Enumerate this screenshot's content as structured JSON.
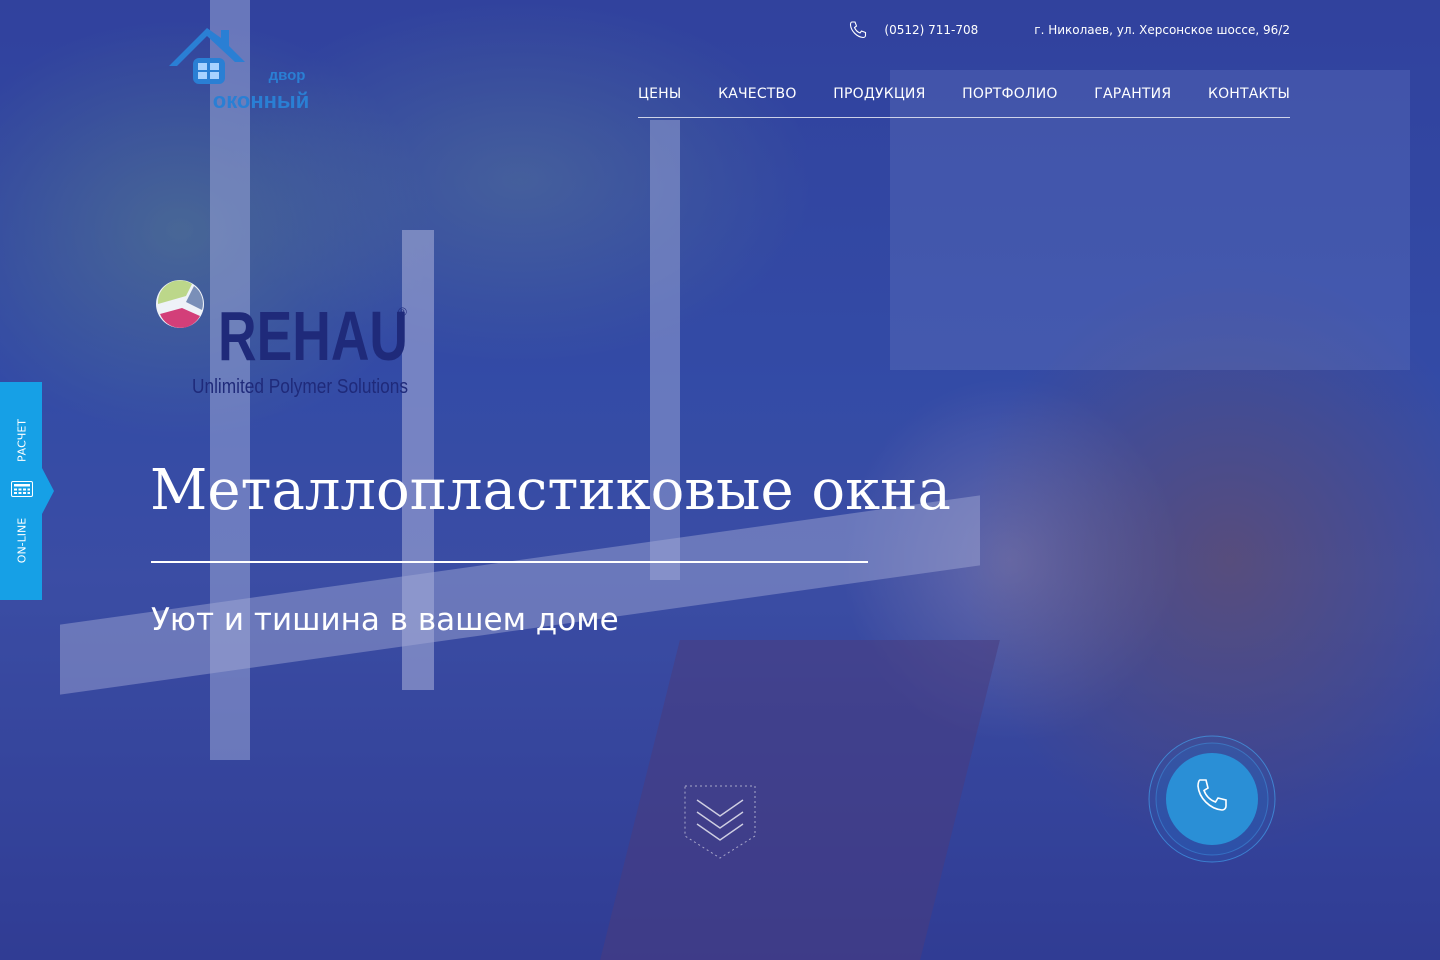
{
  "header": {
    "phone": "(0512) 711-708",
    "address": "г. Николаев,  ул. Херсонское шоссе, 96/2",
    "logo": {
      "line1": "двор",
      "line2": "оконный"
    }
  },
  "nav": {
    "items": [
      "ЦЕНЫ",
      "КАЧЕСТВО",
      "ПРОДУКЦИЯ",
      "ПОРТФОЛИО",
      "ГАРАНТИЯ",
      "КОНТАКТЫ"
    ]
  },
  "brand": {
    "name": "REHAU",
    "tagline": "Unlimited Polymer Solutions",
    "registered": "®"
  },
  "hero": {
    "title": "Металлопластиковые окна",
    "subtitle": "Уют и тишина в вашем доме"
  },
  "side_tab": {
    "label_top": "РАСЧЕТ",
    "label_bottom": "ON-LINE",
    "icon": "calculator-icon"
  },
  "colors": {
    "accent": "#16a0e6",
    "overlay": "#1c288c",
    "brand_text": "#1f2a7a"
  }
}
